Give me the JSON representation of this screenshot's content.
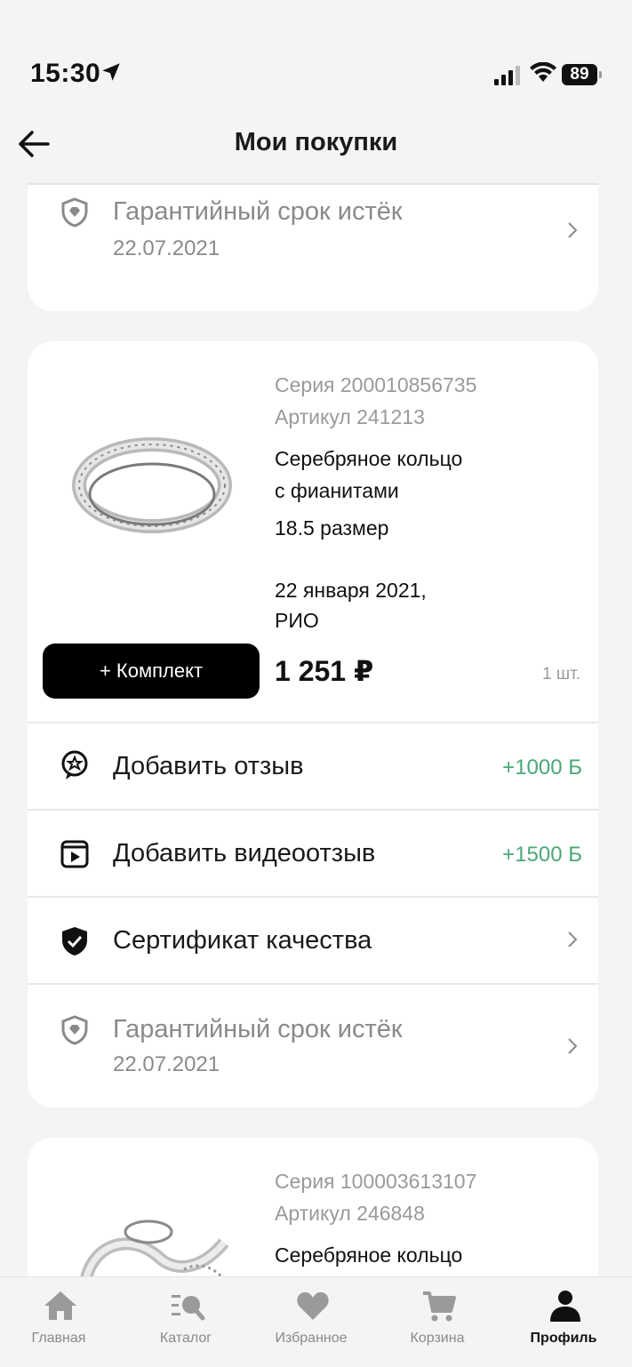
{
  "status": {
    "time": "15:30",
    "battery": "89"
  },
  "header": {
    "title": "Мои покупки"
  },
  "top_card": {
    "warranty_label": "Гарантийный срок истёк",
    "warranty_date": "22.07.2021"
  },
  "purchase_1": {
    "series": "Серия 200010856735",
    "article": "Артикул 241213",
    "name_line1": "Серебряное кольцо",
    "name_line2": "с фианитами",
    "size": "18.5 размер",
    "date": "22 января 2021,",
    "store": "РИО",
    "kit_button": "+ Комплект",
    "price": "1 251 ₽",
    "qty": "1 шт.",
    "actions": {
      "review_label": "Добавить отзыв",
      "review_bonus": "+1000 Б",
      "video_label": "Добавить видеоотзыв",
      "video_bonus": "+1500 Б",
      "certificate_label": "Сертификат качества",
      "warranty_label": "Гарантийный срок истёк",
      "warranty_date": "22.07.2021"
    }
  },
  "purchase_2": {
    "series": "Серия 100003613107",
    "article": "Артикул 246848",
    "name_line1": "Серебряное кольцо"
  },
  "tabbar": {
    "items": [
      {
        "label": "Главная",
        "icon": "home-icon"
      },
      {
        "label": "Каталог",
        "icon": "catalog-search-icon"
      },
      {
        "label": "Избранное",
        "icon": "heart-icon"
      },
      {
        "label": "Корзина",
        "icon": "cart-icon"
      },
      {
        "label": "Профиль",
        "icon": "profile-icon"
      }
    ],
    "active": "Профиль"
  },
  "colors": {
    "bonus": "#4aa877",
    "accent": "#000000",
    "background": "#f4f4f4"
  }
}
